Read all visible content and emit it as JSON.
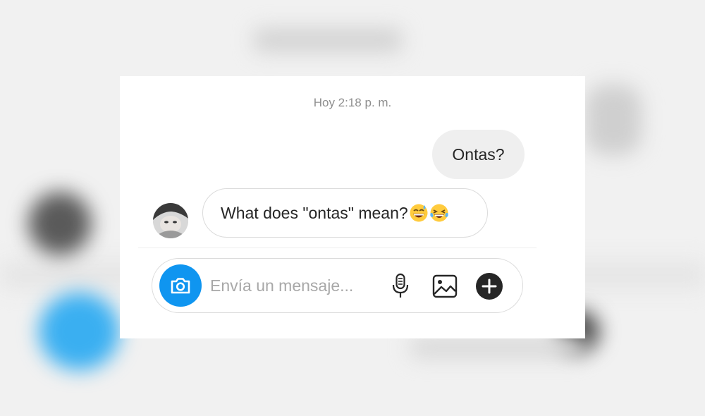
{
  "conversation": {
    "timestamp": "Hoy 2:18 p. m.",
    "messages": [
      {
        "direction": "outgoing",
        "text": "Ontas?"
      },
      {
        "direction": "incoming",
        "text": "What does \"ontas\" mean?",
        "emojis": [
          "grinning-sweat-emoji",
          "tears-of-joy-emoji"
        ]
      }
    ]
  },
  "composer": {
    "placeholder": "Envía un mensaje...",
    "value": "",
    "icons": [
      "camera-icon",
      "microphone-icon",
      "gallery-icon",
      "plus-icon"
    ]
  },
  "colors": {
    "accent": "#0f95f0",
    "outgoing_bubble": "#efefef",
    "border": "#dbdbdb",
    "muted_text": "#8e8e8e"
  }
}
